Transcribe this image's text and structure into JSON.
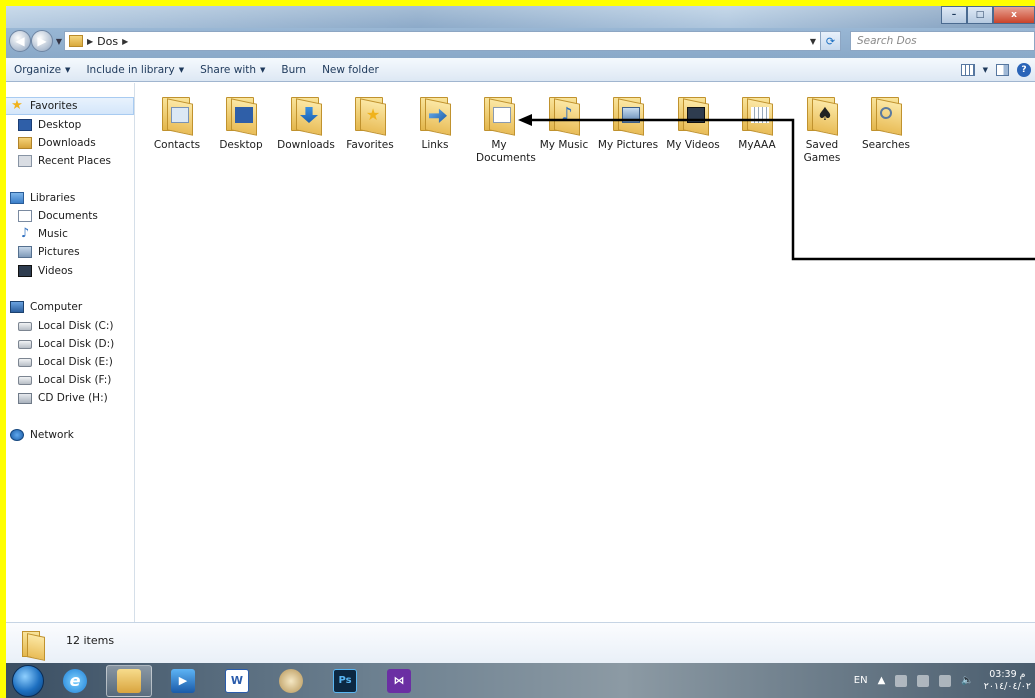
{
  "window": {
    "minimize_label": "–",
    "maximize_label": "□",
    "close_label": "x"
  },
  "address": {
    "crumb": "Dos",
    "search_placeholder": "Search Dos"
  },
  "toolbar": {
    "organize": "Organize",
    "include_in_library": "Include in library",
    "share_with": "Share with",
    "burn": "Burn",
    "new_folder": "New folder",
    "help": "?"
  },
  "nav": {
    "favorites": "Favorites",
    "desktop": "Desktop",
    "downloads": "Downloads",
    "recent_places": "Recent Places",
    "libraries": "Libraries",
    "documents": "Documents",
    "music": "Music",
    "pictures": "Pictures",
    "videos": "Videos",
    "computer": "Computer",
    "disk_c": "Local Disk (C:)",
    "disk_d": "Local Disk (D:)",
    "disk_e": "Local Disk (E:)",
    "disk_f": "Local Disk (F:)",
    "cd_drive": "CD Drive (H:)",
    "network": "Network"
  },
  "items": [
    {
      "label": "Contacts"
    },
    {
      "label": "Desktop"
    },
    {
      "label": "Downloads"
    },
    {
      "label": "Favorites"
    },
    {
      "label": "Links"
    },
    {
      "label": "My Documents"
    },
    {
      "label": "My Music"
    },
    {
      "label": "My Pictures"
    },
    {
      "label": "My Videos"
    },
    {
      "label": "MyAAA"
    },
    {
      "label": "Saved Games"
    },
    {
      "label": "Searches"
    }
  ],
  "details": {
    "count": "12 items"
  },
  "taskbar": {
    "ie": "e",
    "ps": "Ps",
    "word": "W",
    "vs": "⋈",
    "lang": "EN",
    "time": "03:39 م",
    "date": "٢٠١٤/٠٤/٠٢"
  },
  "colors": {
    "frame": "#ffff00",
    "annotation_arrow": "#000000"
  }
}
